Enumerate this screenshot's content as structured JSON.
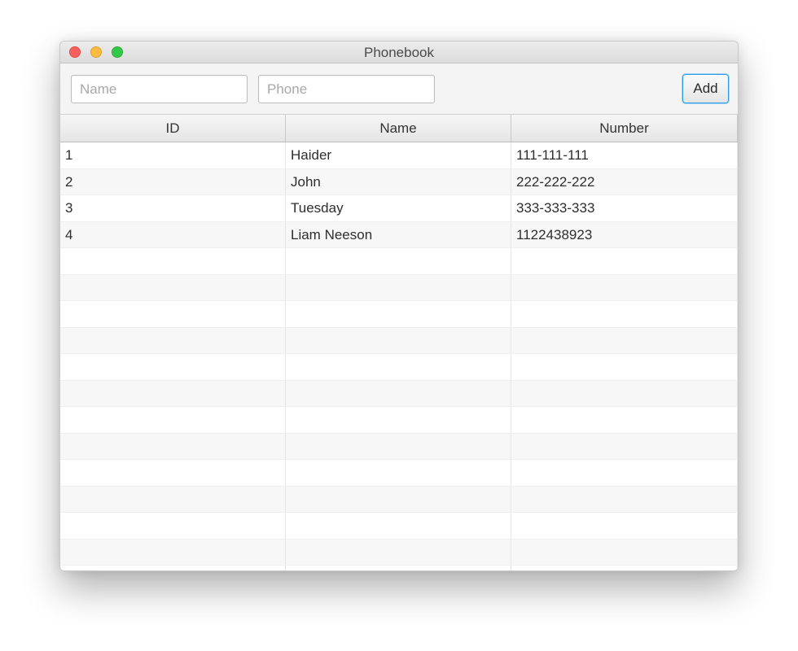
{
  "window": {
    "title": "Phonebook"
  },
  "toolbar": {
    "name_placeholder": "Name",
    "name_value": "",
    "phone_placeholder": "Phone",
    "phone_value": "",
    "add_label": "Add"
  },
  "table": {
    "columns": [
      "ID",
      "Name",
      "Number"
    ],
    "rows": [
      [
        "1",
        "Haider",
        "111-111-111"
      ],
      [
        "2",
        "John",
        "222-222-222"
      ],
      [
        "3",
        "Tuesday",
        "333-333-333"
      ],
      [
        "4",
        "Liam Neeson",
        "1122438923"
      ]
    ]
  },
  "colors": {
    "accent": "#2b9be3",
    "close": "#fc605c",
    "minimize": "#fdbc40",
    "maximize": "#34c84a"
  }
}
